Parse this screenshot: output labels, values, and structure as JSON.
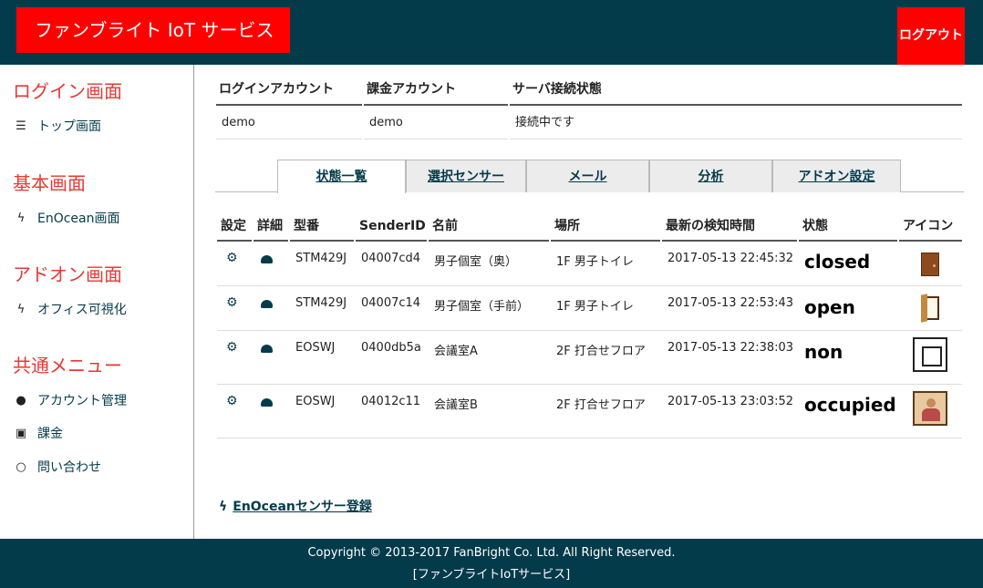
{
  "header": {
    "brand": "ファンブライト IoT サービス",
    "logout_label": "ログアウト",
    "color_header": "#043b4b",
    "color_accent": "#ff0000"
  },
  "sidebar": {
    "sections": [
      {
        "title": "ログイン画面",
        "items": [
          {
            "icon": "menu-icon",
            "label": "トップ画面"
          }
        ]
      },
      {
        "title": "基本画面",
        "items": [
          {
            "icon": "bolt-icon",
            "label": "EnOcean画面"
          }
        ]
      },
      {
        "title": "アドオン画面",
        "items": [
          {
            "icon": "bolt-icon",
            "label": "オフィス可視化"
          }
        ]
      },
      {
        "title": "共通メニュー",
        "items": [
          {
            "icon": "user-icon",
            "label": "アカウント管理"
          },
          {
            "icon": "money-icon",
            "label": "課金"
          },
          {
            "icon": "chat-icon",
            "label": "問い合わせ"
          }
        ]
      }
    ]
  },
  "account": {
    "headers": [
      "ログインアカウント",
      "課金アカウント",
      "サーバ接続状態"
    ],
    "values": [
      "demo",
      "demo",
      "接続中です"
    ]
  },
  "tabs": [
    {
      "label": "状態一覧",
      "active": true
    },
    {
      "label": "選択センサー",
      "active": false
    },
    {
      "label": "メール",
      "active": false
    },
    {
      "label": "分析",
      "active": false
    },
    {
      "label": "アドオン設定",
      "active": false
    }
  ],
  "sensor_table": {
    "headers": [
      "設定",
      "詳細",
      "型番",
      "SenderID",
      "名前",
      "場所",
      "最新の検知時間",
      "状態",
      "アイコン"
    ],
    "rows": [
      {
        "model": "STM429J",
        "sender_id": "04007cd4",
        "name": "男子個室（奥）",
        "location": "1F 男子トイレ",
        "time": "2017-05-13 22:45:32",
        "status": "closed",
        "icon": "door-closed-icon"
      },
      {
        "model": "STM429J",
        "sender_id": "04007c14",
        "name": "男子個室（手前）",
        "location": "1F 男子トイレ",
        "time": "2017-05-13 22:53:43",
        "status": "open",
        "icon": "door-open-icon"
      },
      {
        "model": "EOSWJ",
        "sender_id": "0400db5a",
        "name": "会議室A",
        "location": "2F 打合せフロア",
        "time": "2017-05-13 22:38:03",
        "status": "non",
        "icon": "room-empty-icon"
      },
      {
        "model": "EOSWJ",
        "sender_id": "04012c11",
        "name": "会議室B",
        "location": "2F 打合せフロア",
        "time": "2017-05-13 23:03:52",
        "status": "occupied",
        "icon": "room-occupied-icon"
      }
    ]
  },
  "register_link": "EnOceanセンサー登録",
  "footer": {
    "copyright": "Copyright © 2013-2017 FanBright Co. Ltd. All Right Reserved.",
    "service": "[ファンブライトIoTサービス]"
  }
}
